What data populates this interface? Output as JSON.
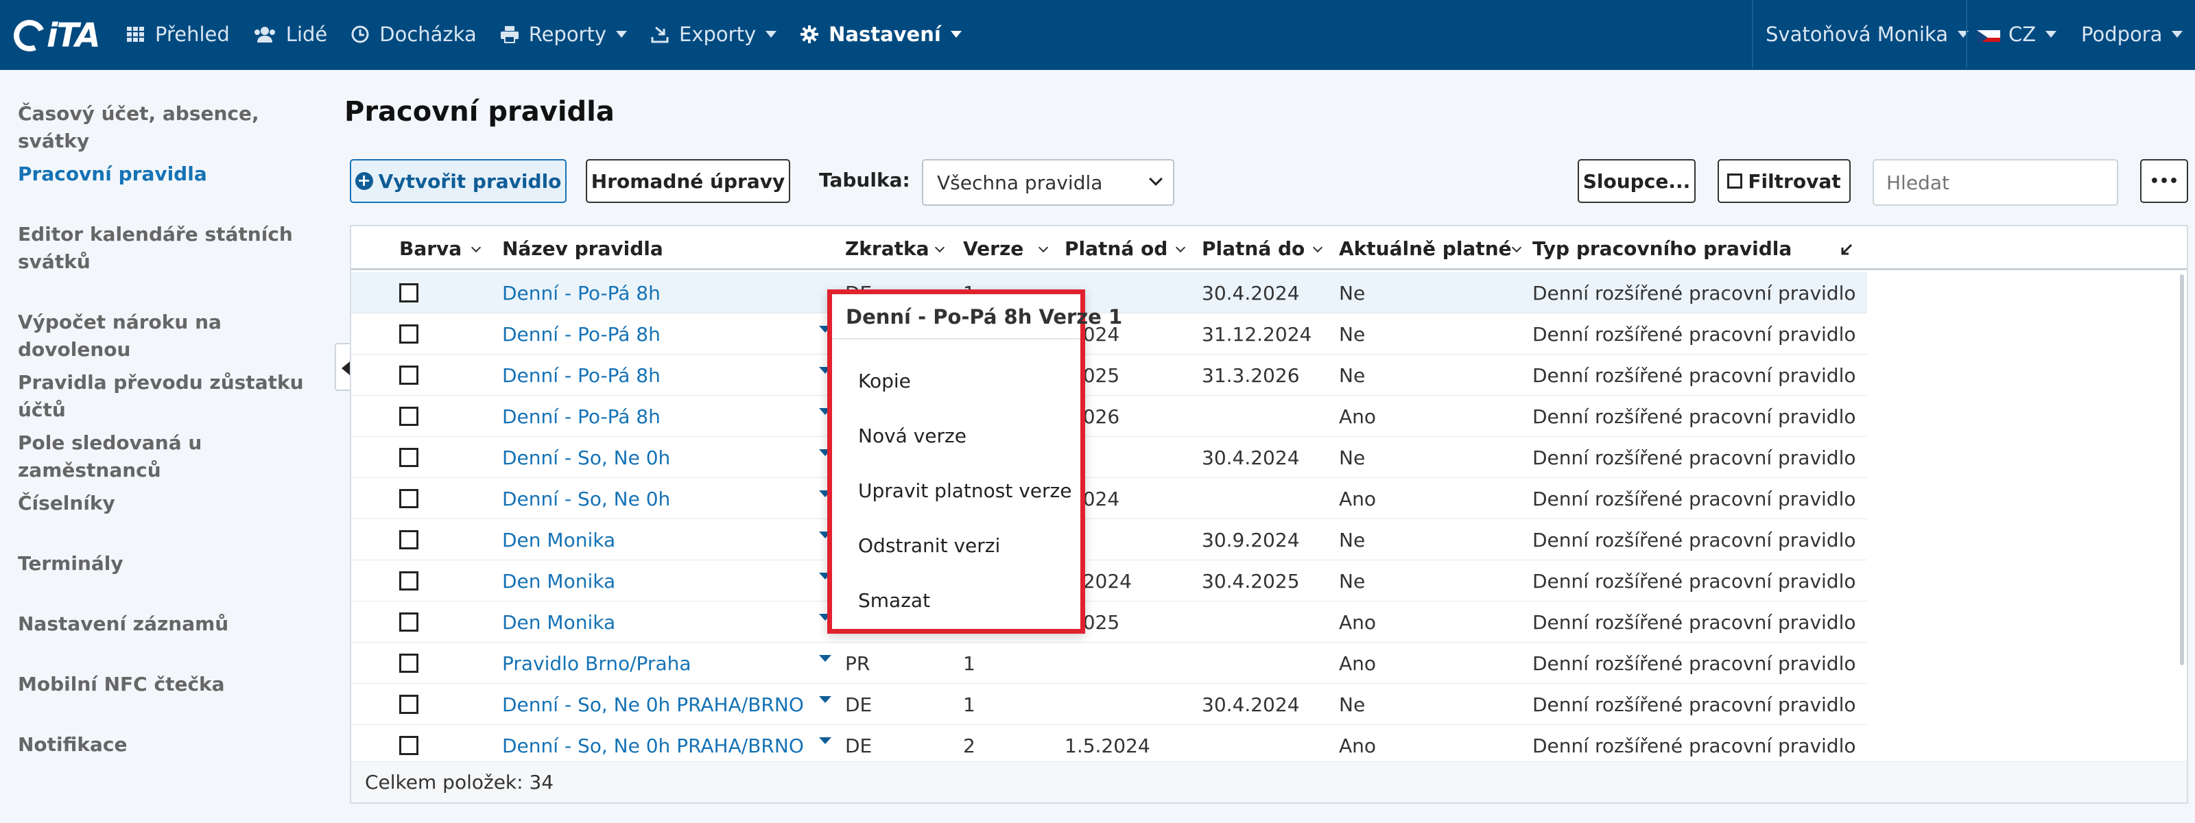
{
  "app": {
    "logo_text": "iTA"
  },
  "nav": {
    "items": [
      {
        "label": "Přehled",
        "icon": "grid-icon"
      },
      {
        "label": "Lidé",
        "icon": "users-icon"
      },
      {
        "label": "Docházka",
        "icon": "clock-icon"
      },
      {
        "label": "Reporty",
        "icon": "printer-icon"
      },
      {
        "label": "Exporty",
        "icon": "export-icon"
      },
      {
        "label": "Nastavení",
        "icon": "gear-icon"
      }
    ],
    "user": "Svatoňová Monika",
    "lang": "CZ",
    "support": "Podpora"
  },
  "sidebar": {
    "items": [
      {
        "label": "Časový účet, absence, svátky"
      },
      {
        "label": "Pracovní pravidla"
      },
      {
        "label": "Editor kalendáře státních svátků"
      },
      {
        "label": "Výpočet nároku na dovolenou"
      },
      {
        "label": "Pravidla převodu zůstatku účtů"
      },
      {
        "label": "Pole sledovaná u zaměstnanců"
      },
      {
        "label": "Číselníky"
      },
      {
        "label": "Terminály"
      },
      {
        "label": "Nastavení záznamů"
      },
      {
        "label": "Mobilní NFC čtečka"
      },
      {
        "label": "Notifikace"
      }
    ]
  },
  "page": {
    "title": "Pracovní pravidla"
  },
  "toolbar": {
    "create_label": "Vytvořit pravidlo",
    "bulk_label": "Hromadné úpravy",
    "table_label": "Tabulka:",
    "table_value": "Všechna pravidla",
    "columns_label": "Sloupce...",
    "filter_label": "Filtrovat",
    "search_placeholder": "Hledat",
    "more_label": "•••"
  },
  "table": {
    "headers": {
      "color": "Barva",
      "name": "Název pravidla",
      "short": "Zkratka",
      "version": "Verze",
      "valid_from": "Platná od",
      "valid_to": "Platná do",
      "current": "Aktuálně platné",
      "type": "Typ pracovního pravidla"
    },
    "rows": [
      {
        "name": "Denní - Po-Pá 8h",
        "short": "DE",
        "version": "1",
        "from": "",
        "to": "30.4.2024",
        "current": "Ne",
        "type": "Denní rozšířené pracovní pravidlo"
      },
      {
        "name": "Denní - Po-Pá 8h",
        "short": "",
        "version": "",
        "from": ".2024",
        "to": "31.12.2024",
        "current": "Ne",
        "type": "Denní rozšířené pracovní pravidlo"
      },
      {
        "name": "Denní - Po-Pá 8h",
        "short": "",
        "version": "",
        "from": ".2025",
        "to": "31.3.2026",
        "current": "Ne",
        "type": "Denní rozšířené pracovní pravidlo"
      },
      {
        "name": "Denní - Po-Pá 8h",
        "short": "",
        "version": "",
        "from": ".2026",
        "to": "",
        "current": "Ano",
        "type": "Denní rozšířené pracovní pravidlo"
      },
      {
        "name": "Denní - So, Ne 0h",
        "short": "",
        "version": "",
        "from": "",
        "to": "30.4.2024",
        "current": "Ne",
        "type": "Denní rozšířené pracovní pravidlo"
      },
      {
        "name": "Denní - So, Ne 0h",
        "short": "",
        "version": "",
        "from": ".2024",
        "to": "",
        "current": "Ano",
        "type": "Denní rozšířené pracovní pravidlo"
      },
      {
        "name": "Den Monika",
        "short": "",
        "version": "",
        "from": "",
        "to": "30.9.2024",
        "current": "Ne",
        "type": "Denní rozšířené pracovní pravidlo"
      },
      {
        "name": "Den Monika",
        "short": "",
        "version": "",
        "from": "0.2024",
        "to": "30.4.2025",
        "current": "Ne",
        "type": "Denní rozšířené pracovní pravidlo"
      },
      {
        "name": "Den Monika",
        "short": "",
        "version": "",
        "from": ".2025",
        "to": "",
        "current": "Ano",
        "type": "Denní rozšířené pracovní pravidlo"
      },
      {
        "name": "Pravidlo Brno/Praha",
        "short": "PR",
        "version": "1",
        "from": "",
        "to": "",
        "current": "Ano",
        "type": "Denní rozšířené pracovní pravidlo"
      },
      {
        "name": "Denní - So, Ne 0h PRAHA/BRNO",
        "short": "DE",
        "version": "1",
        "from": "",
        "to": "30.4.2024",
        "current": "Ne",
        "type": "Denní rozšířené pracovní pravidlo"
      },
      {
        "name": "Denní - So, Ne 0h PRAHA/BRNO",
        "short": "DE",
        "version": "2",
        "from": "1.5.2024",
        "to": "",
        "current": "Ano",
        "type": "Denní rozšířené pracovní pravidlo"
      }
    ],
    "footer": "Celkem položek: 34"
  },
  "context_menu": {
    "title": "Denní - Po-Pá 8h Verze 1",
    "items": [
      {
        "label": "Kopie"
      },
      {
        "label": "Nová verze"
      },
      {
        "label": "Upravit platnost verze"
      },
      {
        "label": "Odstranit verzi"
      },
      {
        "label": "Smazat"
      }
    ]
  },
  "colors": {
    "nav_bg": "#014a80",
    "accent": "#1572b5",
    "highlight_border": "#e0212e"
  }
}
